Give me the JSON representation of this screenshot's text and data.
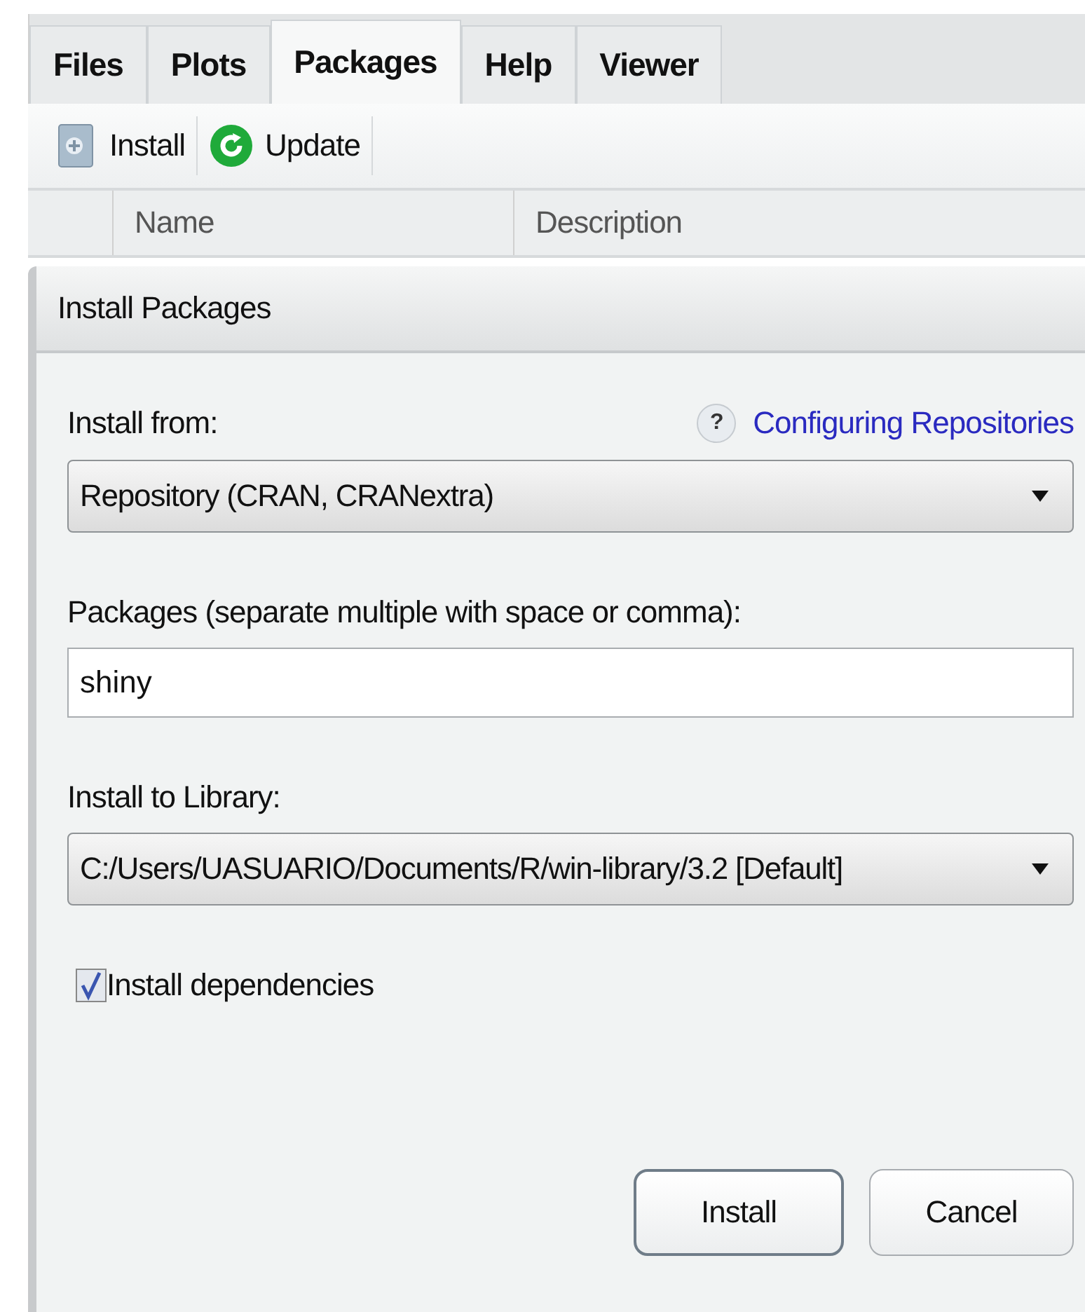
{
  "tabs": [
    {
      "label": "Files",
      "selected": false
    },
    {
      "label": "Plots",
      "selected": false
    },
    {
      "label": "Packages",
      "selected": true
    },
    {
      "label": "Help",
      "selected": false
    },
    {
      "label": "Viewer",
      "selected": false
    }
  ],
  "toolbar": [
    {
      "label": "Install",
      "kind": "install"
    },
    {
      "label": "Update",
      "kind": "update"
    }
  ],
  "table": {
    "columns": [
      "Name",
      "Description"
    ]
  },
  "dialog": {
    "title": "Install Packages",
    "help_icon": "?",
    "help_link": "Configuring Repositories",
    "fields": [
      {
        "kind": "select",
        "label": "Install from:",
        "value": "Repository (CRAN, CRANextra)"
      },
      {
        "kind": "text",
        "label": "Packages (separate multiple with space or comma):",
        "value": "shiny"
      },
      {
        "kind": "select",
        "label": "Install to Library:",
        "value": "C:/Users/UASUARIO/Documents/R/win-library/3.2 [Default]"
      }
    ],
    "checkbox": {
      "label": "Install dependencies",
      "checked": true
    },
    "buttons": [
      {
        "label": "Install",
        "default": true
      },
      {
        "label": "Cancel",
        "default": false
      }
    ]
  }
}
